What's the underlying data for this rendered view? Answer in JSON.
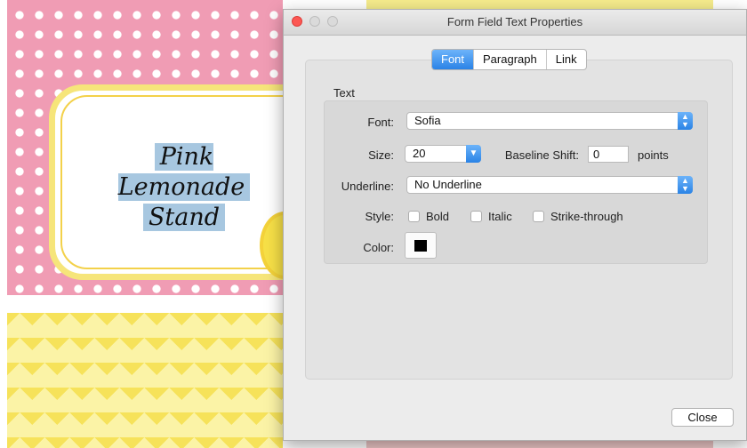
{
  "document": {
    "label_line1": "Pink Lemonade",
    "label_line2": "Stand"
  },
  "window": {
    "title": "Form Field Text Properties"
  },
  "tabs": [
    {
      "label": "Font",
      "active": true
    },
    {
      "label": "Paragraph",
      "active": false
    },
    {
      "label": "Link",
      "active": false
    }
  ],
  "text_section": {
    "title": "Text",
    "font": {
      "label": "Font:",
      "value": "Sofia"
    },
    "size": {
      "label": "Size:",
      "value": "20"
    },
    "baseline": {
      "label": "Baseline Shift:",
      "value": "0",
      "unit": "points"
    },
    "underline": {
      "label": "Underline:",
      "value": "No Underline"
    },
    "style": {
      "label": "Style:",
      "bold": {
        "label": "Bold",
        "checked": false
      },
      "italic": {
        "label": "Italic",
        "checked": false
      },
      "strike": {
        "label": "Strike-through",
        "checked": false
      }
    },
    "color": {
      "label": "Color:",
      "value": "#000000"
    }
  },
  "buttons": {
    "close": "Close"
  },
  "colors": {
    "accent": "#2a83e6",
    "pink_background": "#f09cb4",
    "yellow_background": "#f6e25a"
  }
}
